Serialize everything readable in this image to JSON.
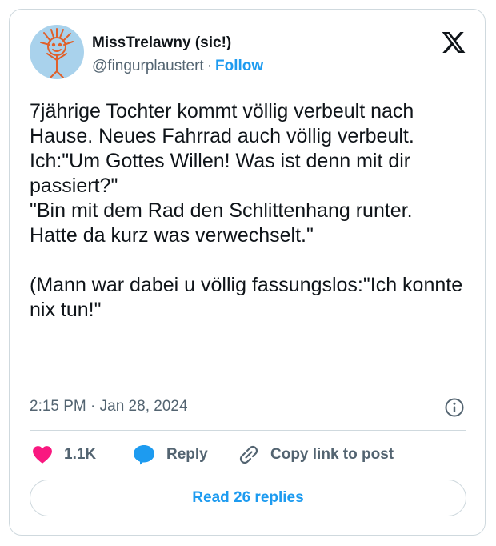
{
  "author": {
    "name": "MissTrelawny (sic!)",
    "handle": "@fingurplaustert",
    "separator": "·",
    "follow_label": "Follow"
  },
  "tweet": {
    "text": "7jährige Tochter kommt völlig verbeult nach Hause. Neues Fahrrad auch völlig verbeult. Ich:\"Um Gottes Willen! Was ist denn mit dir passiert?\"\n\"Bin mit dem Rad den Schlittenhang runter.\nHatte da kurz was verwechselt.\"\n\n(Mann war dabei u völlig fassungslos:\"Ich konnte nix tun!\"",
    "timestamp": "2:15 PM · Jan 28, 2024"
  },
  "actions": {
    "likes_count": "1.1K",
    "reply_label": "Reply",
    "copy_link_label": "Copy link to post"
  },
  "read_replies_label": "Read 26 replies",
  "icons": {
    "logo": "x-logo-icon",
    "info": "info-icon",
    "like": "heart-icon",
    "reply": "speech-bubble-icon",
    "copy": "link-icon"
  },
  "colors": {
    "accent": "#1d9bf0",
    "like": "#f91880",
    "text": "#0f1419",
    "secondary_text": "#536471",
    "border": "#cfd9de",
    "avatar_bg": "#a9d2ec"
  }
}
